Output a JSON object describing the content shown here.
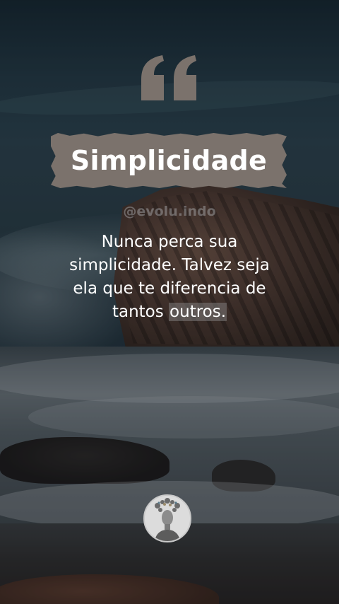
{
  "title": "Simplicidade",
  "handle": "@evolu.indo",
  "quote": {
    "line1": "Nunca perca sua",
    "line2": "simplicidade. Talvez seja",
    "line3": "ela que te diferencia de",
    "line4_before": "tantos ",
    "line4_highlight": "outros."
  },
  "icons": {
    "quote": "quotation-mark-icon",
    "avatar": "profile-avatar-icon"
  },
  "colors": {
    "banner": "#7b726c",
    "quote_mark": "#7b726c",
    "text": "#ffffff"
  }
}
